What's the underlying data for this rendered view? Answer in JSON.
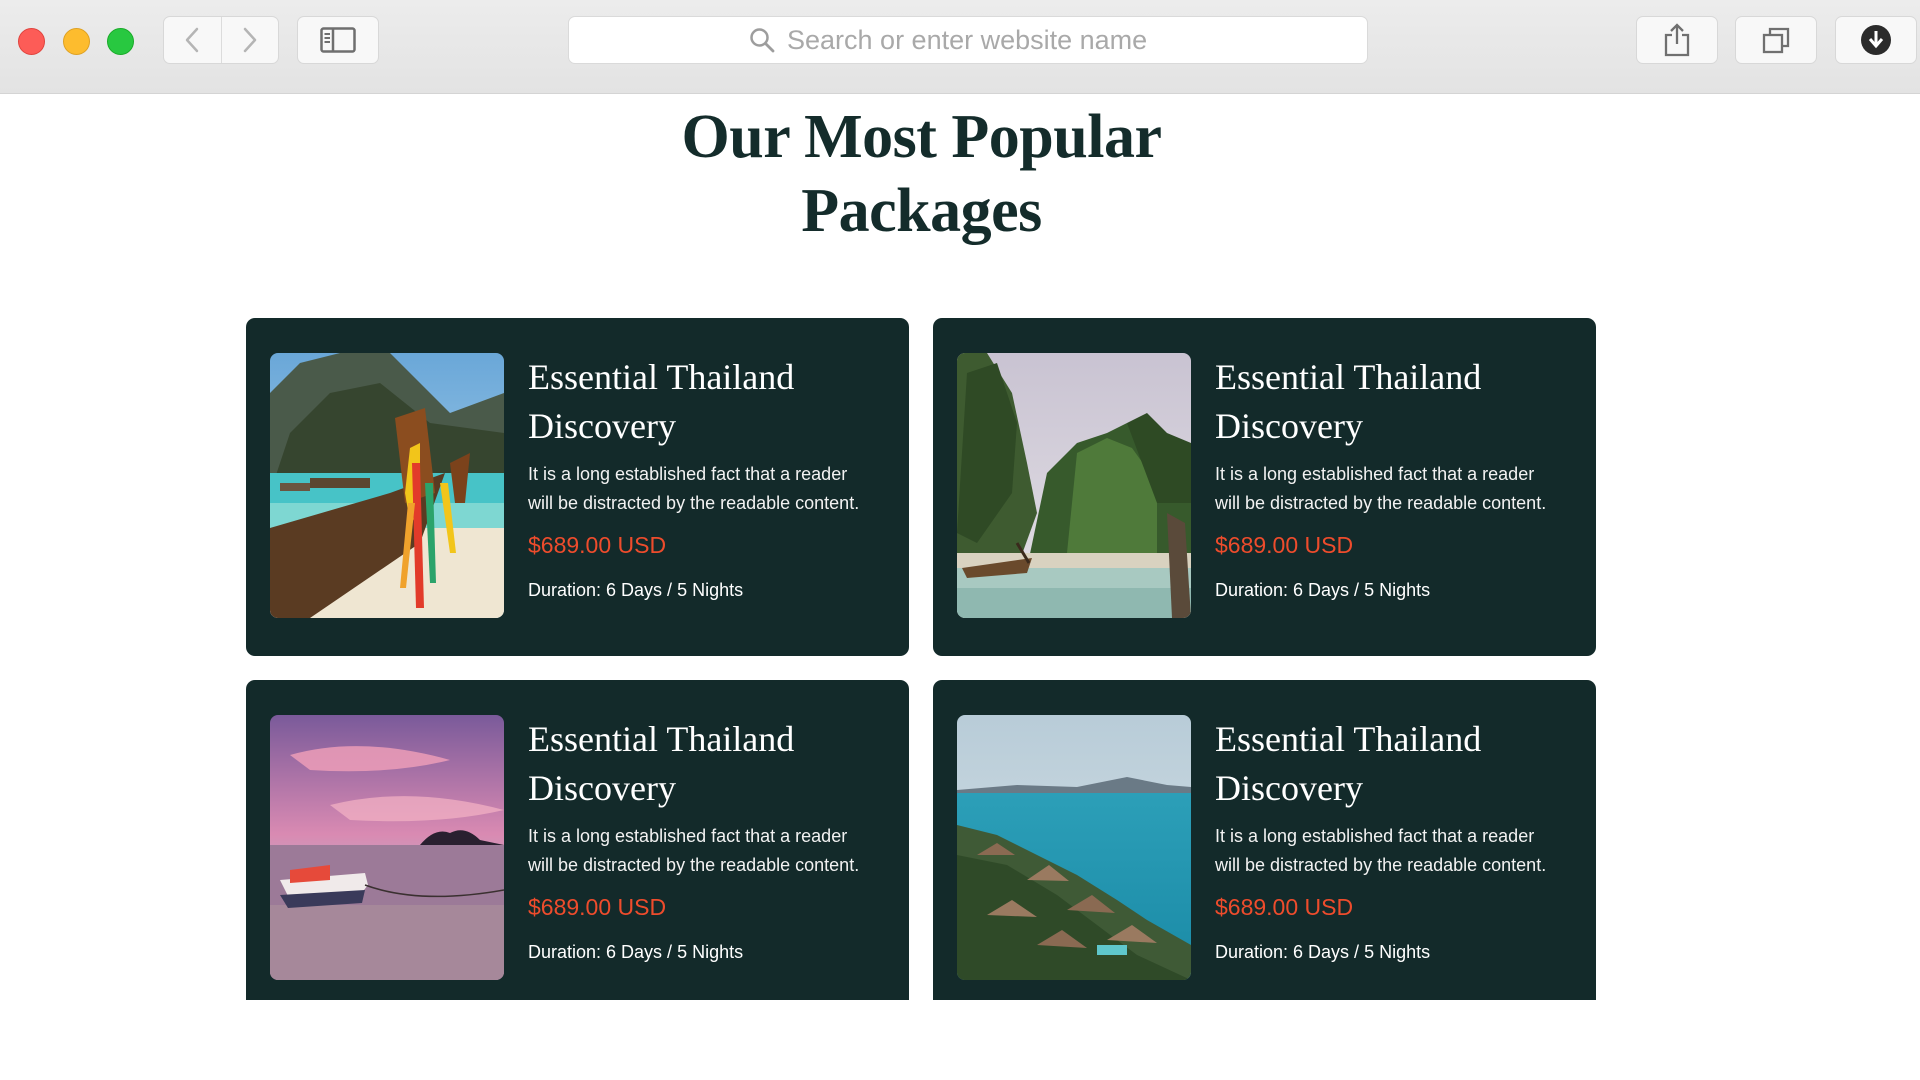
{
  "browser": {
    "address_placeholder": "Search or enter website name"
  },
  "page": {
    "heading_line1": "Our Most Popular",
    "heading_line2": "Packages"
  },
  "packages": [
    {
      "title_line1": "Essential Thailand",
      "title_line2": "Discovery",
      "description_line1": "It is a long established fact that a reader",
      "description_line2": "will be distracted by the readable content.",
      "price": "$689.00 USD",
      "duration": "Duration: 6 Days / 5 Nights",
      "image": "longtail-boats-beach"
    },
    {
      "title_line1": "Essential Thailand",
      "title_line2": "Discovery",
      "description_line1": "It is a long established fact that a reader",
      "description_line2": "will be distracted by the readable content.",
      "price": "$689.00 USD",
      "duration": "Duration: 6 Days / 5 Nights",
      "image": "limestone-cliffs-cove"
    },
    {
      "title_line1": "Essential Thailand",
      "title_line2": "Discovery",
      "description_line1": "It is a long established fact that a reader",
      "description_line2": "will be distracted by the readable content.",
      "price": "$689.00 USD",
      "duration": "Duration: 6 Days / 5 Nights",
      "image": "sunset-boat-sea"
    },
    {
      "title_line1": "Essential Thailand",
      "title_line2": "Discovery",
      "description_line1": "It is a long established fact that a reader",
      "description_line2": "will be distracted by the readable content.",
      "price": "$689.00 USD",
      "duration": "Duration: 6 Days / 5 Nights",
      "image": "coastal-resort-bay"
    }
  ],
  "colors": {
    "card_background": "#132a2a",
    "price": "#ee4c2c",
    "heading": "#142c2b"
  }
}
